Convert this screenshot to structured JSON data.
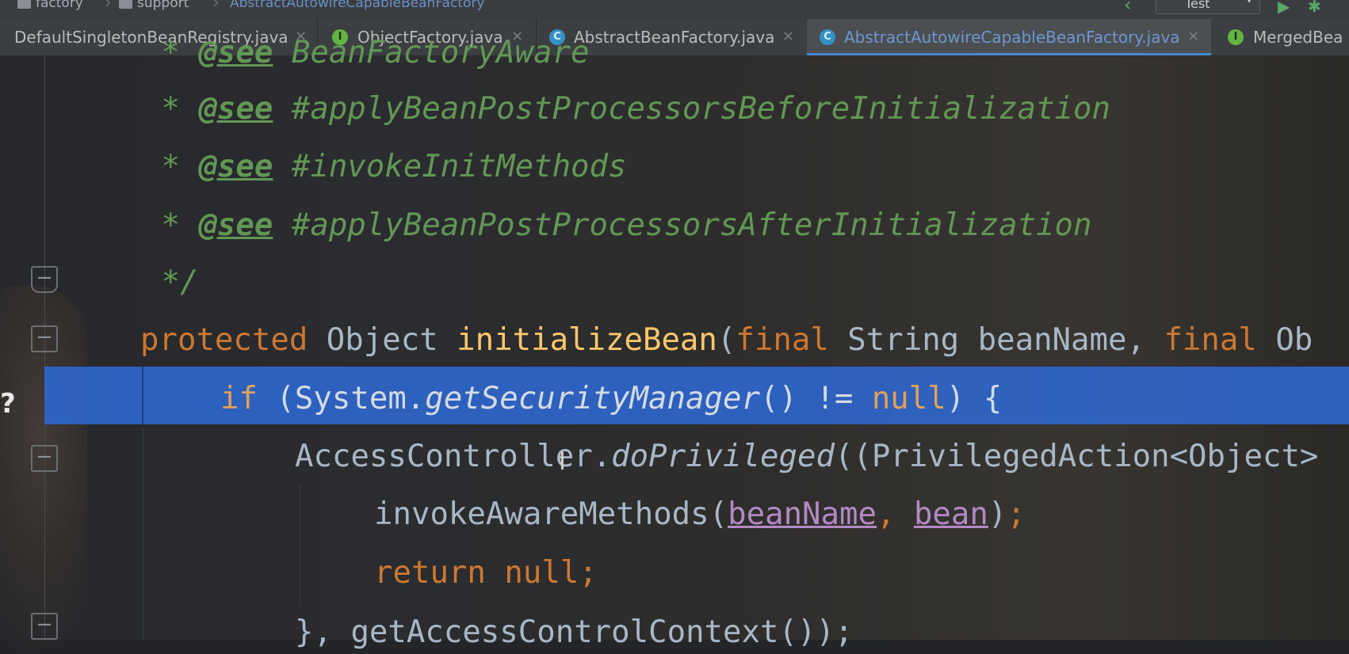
{
  "breadcrumb": {
    "items": [
      "factory",
      "support",
      "AbstractAutowireCapableBeanFactory"
    ]
  },
  "toolbar": {
    "run_config": "Test",
    "run_config_arrow": "▾",
    "back_icon": "back-arrow-icon",
    "run_icon": "run-icon",
    "debug_icon": "debug-icon"
  },
  "tabs": [
    {
      "name": "DefaultSingletonBeanRegistry.java",
      "icon": "",
      "close": "×",
      "active": false
    },
    {
      "name": "ObjectFactory.java",
      "icon": "I",
      "close": "×",
      "active": false
    },
    {
      "name": "AbstractBeanFactory.java",
      "icon": "C",
      "close": "×",
      "active": false
    },
    {
      "name": "AbstractAutowireCapableBeanFactory.java",
      "icon": "C",
      "close": "×",
      "active": true
    },
    {
      "name": "MergedBea",
      "icon": "I",
      "close": "",
      "active": false
    }
  ],
  "gutter": {
    "fold_minus": "−",
    "question_mark": "?"
  },
  "code": {
    "l0": {
      "star": " * ",
      "tag": "@see",
      "text": " BeanFactoryAware"
    },
    "l1": {
      "star": " * ",
      "tag": "@see",
      "text": " #applyBeanPostProcessorsBeforeInitialization"
    },
    "l2": {
      "star": " * ",
      "tag": "@see",
      "text": " #invokeInitMethods"
    },
    "l3": {
      "star": " * ",
      "tag": "@see",
      "text": " #applyBeanPostProcessorsAfterInitialization"
    },
    "l4": {
      "text": " */"
    },
    "l5": {
      "kw1": "protected",
      "t1": " Object ",
      "method": "initializeBean",
      "t2": "(",
      "kw2": "final",
      "t3": " String beanName, ",
      "kw3": "final",
      "t4": " Ob"
    },
    "l6": {
      "kw1": "if",
      "t1": " (System.",
      "static": "getSecurityManager",
      "t2": "() != ",
      "kw2": "null",
      "t3": ") {"
    },
    "l7": {
      "t1": "AccessController.",
      "static": "doPrivileged",
      "t2": "((PrivilegedAction<Object>"
    },
    "l8": {
      "t1": "invokeAwareMethods(",
      "p1": "beanName",
      "t2": ", ",
      "p2": "bean",
      "t3": ")",
      "semi": ";"
    },
    "l9": {
      "kw1": "return",
      "t1": " ",
      "kw2": "null",
      "semi": ";"
    },
    "l10": {
      "t1": "}, getAccessControlContext());"
    }
  },
  "colors": {
    "selection": "#2f65ca",
    "comment": "#629755",
    "keyword": "#cc7832",
    "method": "#ffc66d",
    "param": "#b389c5"
  }
}
